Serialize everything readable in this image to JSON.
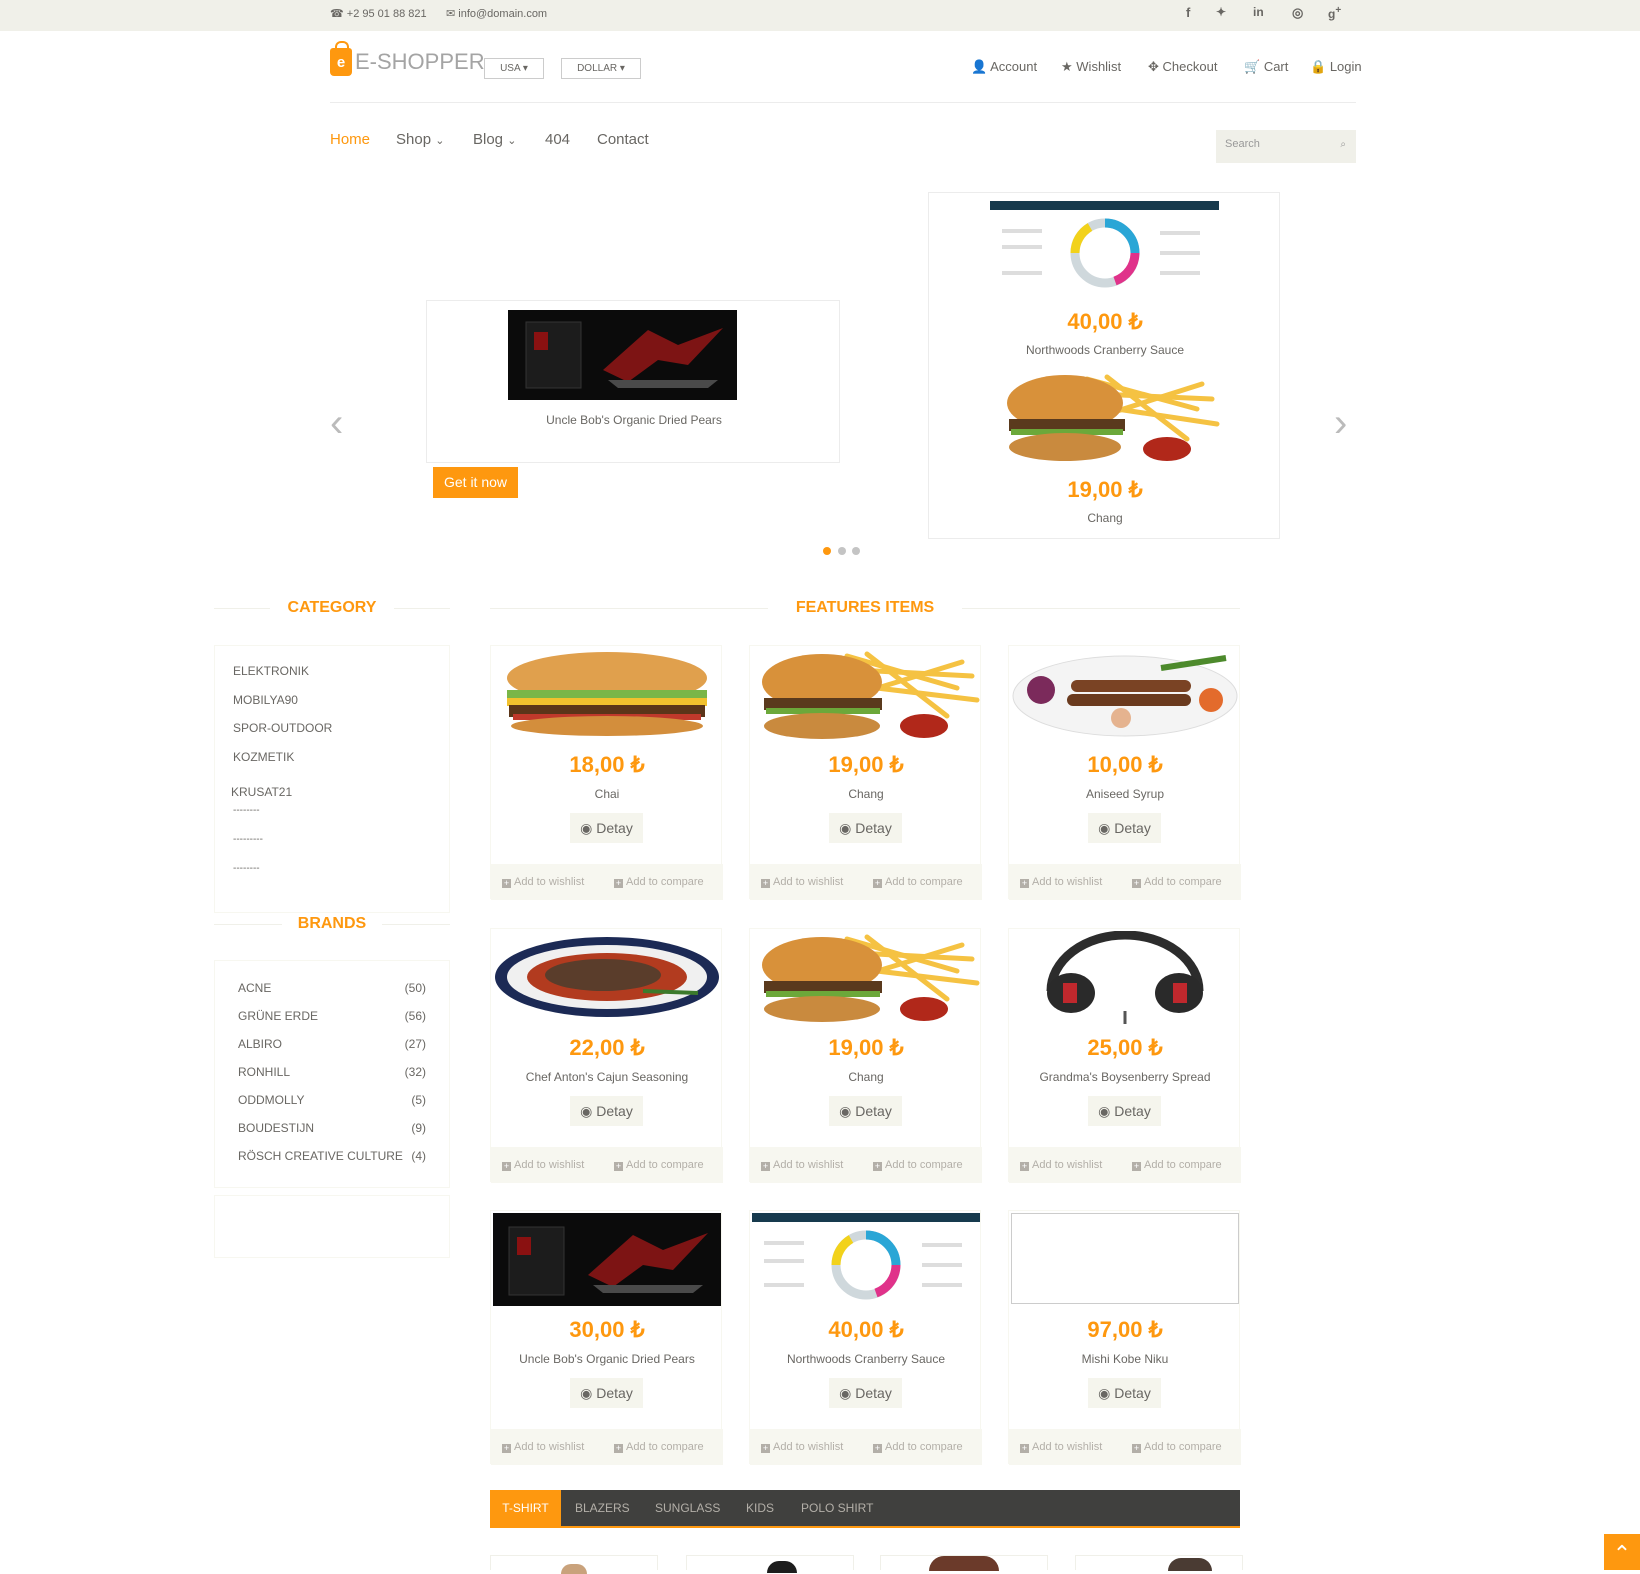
{
  "topbar": {
    "phone": "+2 95 01 88 821",
    "email": "info@domain.com",
    "social": [
      "f",
      "t",
      "in",
      "dribbble",
      "g+"
    ]
  },
  "header": {
    "logo_letter": "e",
    "logo_text": "E-SHOPPER",
    "country": "USA",
    "currency": "DOLLAR",
    "links": [
      "Account",
      "Wishlist",
      "Checkout",
      "Cart",
      "Login"
    ]
  },
  "nav": {
    "items": [
      "Home",
      "Shop",
      "Blog",
      "404",
      "Contact"
    ],
    "search_placeholder": "Search"
  },
  "slider": {
    "left": {
      "name": "Uncle Bob's Organic Dried Pears",
      "button": "Get it now"
    },
    "right": [
      {
        "price": "40,00 ₺",
        "name": "Northwoods Cranberry Sauce"
      },
      {
        "price": "19,00 ₺",
        "name": "Chang"
      }
    ]
  },
  "category": {
    "title": "CATEGORY",
    "items": [
      "ELEKTRONIK",
      "MOBILYA90",
      "SPOR-OUTDOOR",
      "KOZMETIK",
      "KRUSAT21",
      "--------",
      "---------",
      "--------"
    ]
  },
  "brands": {
    "title": "BRANDS",
    "items": [
      {
        "name": "ACNE",
        "count": "(50)"
      },
      {
        "name": "GRÜNE ERDE",
        "count": "(56)"
      },
      {
        "name": "ALBIRO",
        "count": "(27)"
      },
      {
        "name": "RONHILL",
        "count": "(32)"
      },
      {
        "name": "ODDMOLLY",
        "count": "(5)"
      },
      {
        "name": "BOUDESTIJN",
        "count": "(9)"
      },
      {
        "name": "RÖSCH CREATIVE CULTURE",
        "count": "(4)"
      }
    ]
  },
  "features": {
    "title": "FEATURES ITEMS",
    "detail_label": "Detay",
    "wishlist_label": "Add to wishlist",
    "compare_label": "Add to compare",
    "products": [
      {
        "price": "18,00 ₺",
        "name": "Chai",
        "image": "burger"
      },
      {
        "price": "19,00 ₺",
        "name": "Chang",
        "image": "burger-fries"
      },
      {
        "price": "10,00 ₺",
        "name": "Aniseed Syrup",
        "image": "kebab-plate"
      },
      {
        "price": "22,00 ₺",
        "name": "Chef Anton's Cajun Seasoning",
        "image": "meat-plate"
      },
      {
        "price": "19,00 ₺",
        "name": "Chang",
        "image": "burger-fries"
      },
      {
        "price": "25,00 ₺",
        "name": "Grandma's Boysenberry Spread",
        "image": "headphones"
      },
      {
        "price": "30,00 ₺",
        "name": "Uncle Bob's Organic Dried Pears",
        "image": "dragon-box"
      },
      {
        "price": "40,00 ₺",
        "name": "Northwoods Cranberry Sauce",
        "image": "chart-infographic"
      },
      {
        "price": "97,00 ₺",
        "name": "Mishi Kobe Niku",
        "image": "blank"
      }
    ]
  },
  "tabs": [
    "T-SHIRT",
    "BLAZERS",
    "SUNGLASS",
    "KIDS",
    "POLO SHIRT"
  ],
  "colors": {
    "accent": "#FE980F",
    "topbar": "#F0F0E9",
    "text": "#696763",
    "tabbar": "#40403E"
  }
}
